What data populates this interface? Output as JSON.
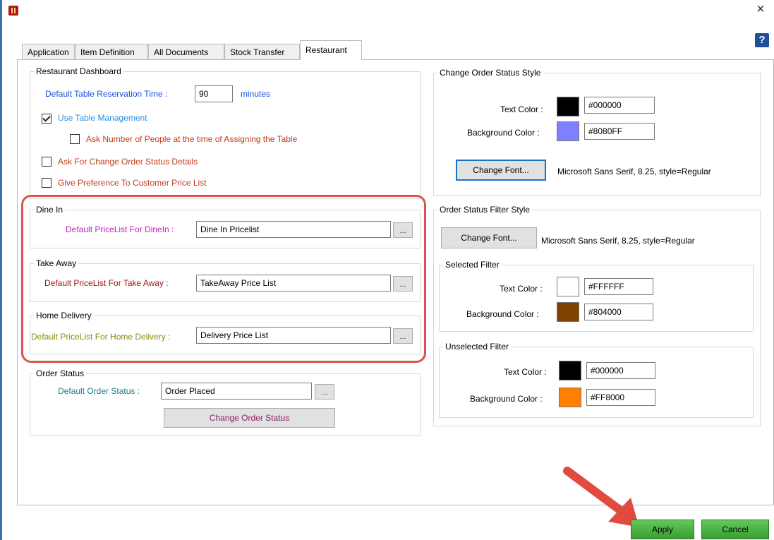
{
  "window": {
    "close_glyph": "×",
    "help_glyph": "?"
  },
  "tabs": [
    {
      "label": "Application"
    },
    {
      "label": "Item Definition"
    },
    {
      "label": "All Documents"
    },
    {
      "label": "Stock Transfer"
    },
    {
      "label": "Restaurant",
      "active": true
    }
  ],
  "restaurant_dashboard": {
    "legend": "Restaurant Dashboard",
    "reservation_label": "Default Table Reservation Time :",
    "reservation_value": "90",
    "reservation_unit": "minutes",
    "use_table_management": {
      "label": "Use Table Management",
      "checked": true
    },
    "ask_people": {
      "label": "Ask Number of People at the time of Assigning the Table",
      "checked": false
    },
    "ask_change_status": {
      "label": "Ask For Change Order Status Details",
      "checked": false
    },
    "prefer_customer_pricelist": {
      "label": "Give Preference To Customer  Price List",
      "checked": false
    }
  },
  "dine_in": {
    "legend": "Dine In",
    "label": "Default PriceList For DineIn :",
    "value": "Dine In Pricelist",
    "browse": "..."
  },
  "take_away": {
    "legend": "Take Away",
    "label": "Default PriceList For Take Away :",
    "value": "TakeAway Price List",
    "browse": "..."
  },
  "home_delivery": {
    "legend": "Home Delivery",
    "label": "Default PriceList For Home Delivery :",
    "value": "Delivery Price List",
    "browse": "..."
  },
  "order_status": {
    "legend": "Order Status",
    "label": "Default Order Status :",
    "value": "Order Placed",
    "browse": "...",
    "change_button": "Change Order Status"
  },
  "change_order_status_style": {
    "legend": "Change Order Status Style",
    "text_color_label": "Text Color :",
    "text_color": "#000000",
    "bg_color_label": "Background Color :",
    "bg_color": "#8080FF",
    "change_font_button": "Change Font...",
    "font_desc": "Microsoft Sans Serif, 8.25, style=Regular"
  },
  "order_status_filter_style": {
    "legend": "Order Status Filter Style",
    "change_font_button": "Change Font...",
    "font_desc": "Microsoft Sans Serif, 8.25, style=Regular",
    "selected": {
      "legend": "Selected Filter",
      "text_color_label": "Text Color :",
      "text_color": "#FFFFFF",
      "bg_color_label": "Background Color :",
      "bg_color": "#804000"
    },
    "unselected": {
      "legend": "Unselected Filter",
      "text_color_label": "Text Color :",
      "text_color": "#000000",
      "bg_color_label": "Background Color :",
      "bg_color": "#FF8000"
    }
  },
  "footer": {
    "apply": "Apply",
    "cancel": "Cancel"
  },
  "annotation_colors": {
    "highlight": "#d9534f",
    "arrow": "#e04a3f"
  }
}
